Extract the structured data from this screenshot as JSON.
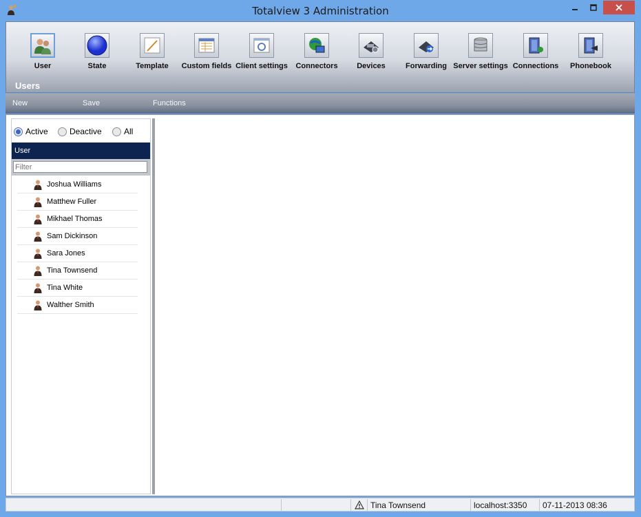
{
  "window": {
    "title": "Totalview 3  Administration"
  },
  "toolbar": {
    "items": [
      {
        "label": "User",
        "icon": "user-group-icon",
        "active": true
      },
      {
        "label": "State",
        "icon": "state-orb-icon"
      },
      {
        "label": "Template",
        "icon": "template-icon"
      },
      {
        "label": "Custom fields",
        "icon": "custom-fields-icon"
      },
      {
        "label": "Client settings",
        "icon": "client-settings-icon"
      },
      {
        "label": "Connectors",
        "icon": "connectors-icon"
      },
      {
        "label": "Devices",
        "icon": "devices-icon"
      },
      {
        "label": "Forwarding",
        "icon": "forwarding-icon"
      },
      {
        "label": "Server settings",
        "icon": "server-settings-icon"
      },
      {
        "label": "Connections",
        "icon": "connections-icon"
      },
      {
        "label": "Phonebook",
        "icon": "phonebook-icon"
      }
    ],
    "section_title": "Users"
  },
  "actions": {
    "new": "New",
    "save": "Save",
    "functions": "Functions"
  },
  "filter": {
    "active": "Active",
    "deactive": "Deactive",
    "all": "All",
    "selected": "Active"
  },
  "user_list": {
    "header": "User",
    "filter_placeholder": "Filter",
    "users": [
      "Joshua Williams",
      "Matthew Fuller",
      "Mikhael Thomas",
      "Sam Dickinson",
      "Sara Jones",
      "Tina Townsend",
      "Tina White",
      "Walther Smith"
    ]
  },
  "status": {
    "user": "Tina Townsend",
    "server": "localhost:3350",
    "datetime": "07-11-2013 08:36"
  }
}
